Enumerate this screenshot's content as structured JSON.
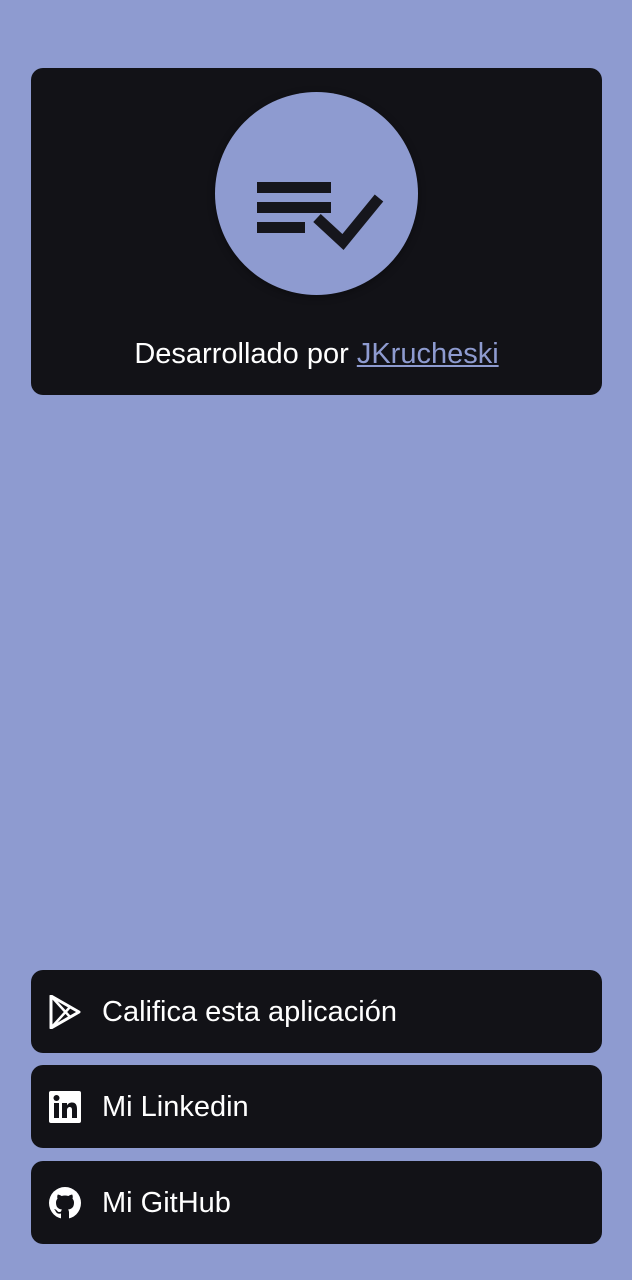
{
  "about": {
    "logo_icon": "checklist-icon",
    "credit_prefix": "Desarrollado por",
    "author_link": "JKrucheski"
  },
  "actions": [
    {
      "label": "Califica esta aplicación",
      "icon": "play-store-icon"
    },
    {
      "label": "Mi Linkedin",
      "icon": "linkedin-icon"
    },
    {
      "label": "Mi GitHub",
      "icon": "github-icon"
    }
  ],
  "colors": {
    "background": "#8e9bd0",
    "card": "#121217",
    "accent_link": "#8e9bd0",
    "text": "#ffffff"
  }
}
